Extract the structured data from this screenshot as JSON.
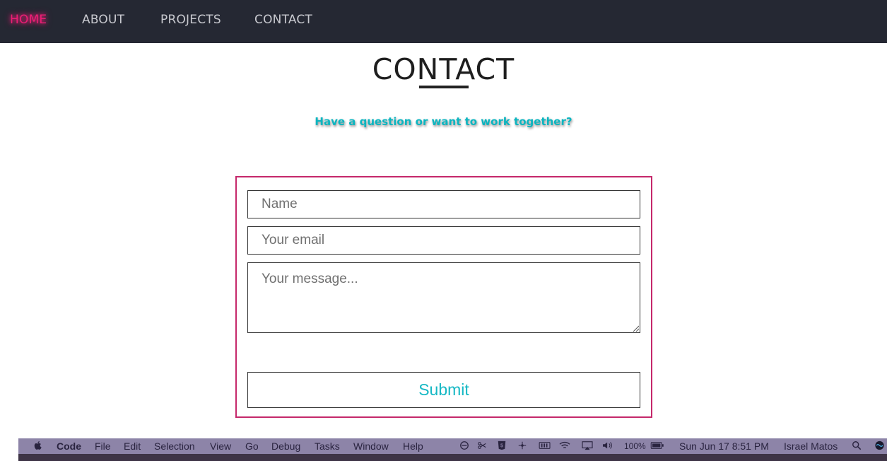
{
  "nav": {
    "items": [
      {
        "label": "HOME",
        "active": true
      },
      {
        "label": "ABOUT"
      },
      {
        "label": "PROJECTS"
      },
      {
        "label": "CONTACT"
      }
    ]
  },
  "contact": {
    "heading": "CONTACT",
    "subtitle": "Have a question or want to work together?",
    "form": {
      "name_placeholder": "Name",
      "email_placeholder": "Your email",
      "message_placeholder": "Your message...",
      "submit_label": "Submit"
    }
  },
  "menubar": {
    "app": "Code",
    "menus": [
      "File",
      "Edit",
      "Selection",
      "View",
      "Go",
      "Debug",
      "Tasks",
      "Window",
      "Help"
    ],
    "battery": "100%",
    "datetime": "Sun Jun 17  8:51 PM",
    "user": "Israel Matos",
    "icons": [
      "apple-icon",
      "clock-icon",
      "scissors-icon",
      "html5-icon",
      "move-icon",
      "battery-widget-icon",
      "wifi-icon",
      "airplay-icon",
      "volume-icon",
      "battery-icon",
      "search-icon",
      "siri-icon"
    ]
  },
  "colors": {
    "nav_bg": "#252833",
    "active_nav": "#ee1e76",
    "accent_teal": "#0bb5c0",
    "form_border": "#c5286b",
    "menubar_bg": "#8d84a8"
  }
}
